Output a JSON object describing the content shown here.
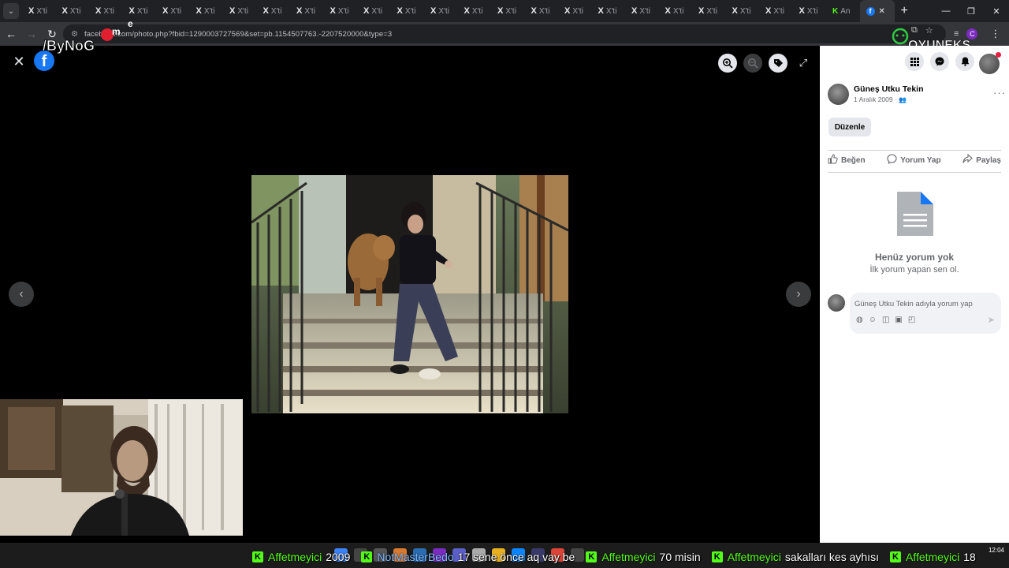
{
  "browser": {
    "tab_label": "X'ti",
    "tab_label_kick": "An",
    "url": "facebook.com/photo.php?fbid=1290003727569&set=pb.1154507763.-2207520000&type=3",
    "new_tab": "+",
    "profile_initial": "C"
  },
  "overlays": {
    "bynogame": "ByNoGame",
    "oyuneks": "OYUNEKS"
  },
  "viewer": {
    "fb_logo": "f"
  },
  "post": {
    "author": "Güneş Utku Tekin",
    "date": "1 Aralık 2009 ·",
    "edit_label": "Düzenle",
    "actions": {
      "like": "Beğen",
      "comment": "Yorum Yap",
      "share": "Paylaş"
    },
    "no_comments_title": "Henüz yorum yok",
    "no_comments_sub": "İlk yorum yapan sen ol.",
    "comment_placeholder": "Güneş Utku Tekin adıyla yorum yap"
  },
  "chat": [
    {
      "user": "Affetmeyici",
      "msg": "2009",
      "color": "#53fc18"
    },
    {
      "user": "NotMasterBedo",
      "msg": "17 sene önce aq vay be",
      "color": "#7ab8ff"
    },
    {
      "user": "Affetmeyici",
      "msg": "70 misin",
      "color": "#53fc18"
    },
    {
      "user": "Affetmeyici",
      "msg": "sakalları kes ayhısı",
      "color": "#53fc18"
    },
    {
      "user": "Affetmeyici",
      "msg": "18",
      "color": "#53fc18"
    }
  ],
  "clock": {
    "time": "12:04",
    "date": "26.10.2026"
  }
}
